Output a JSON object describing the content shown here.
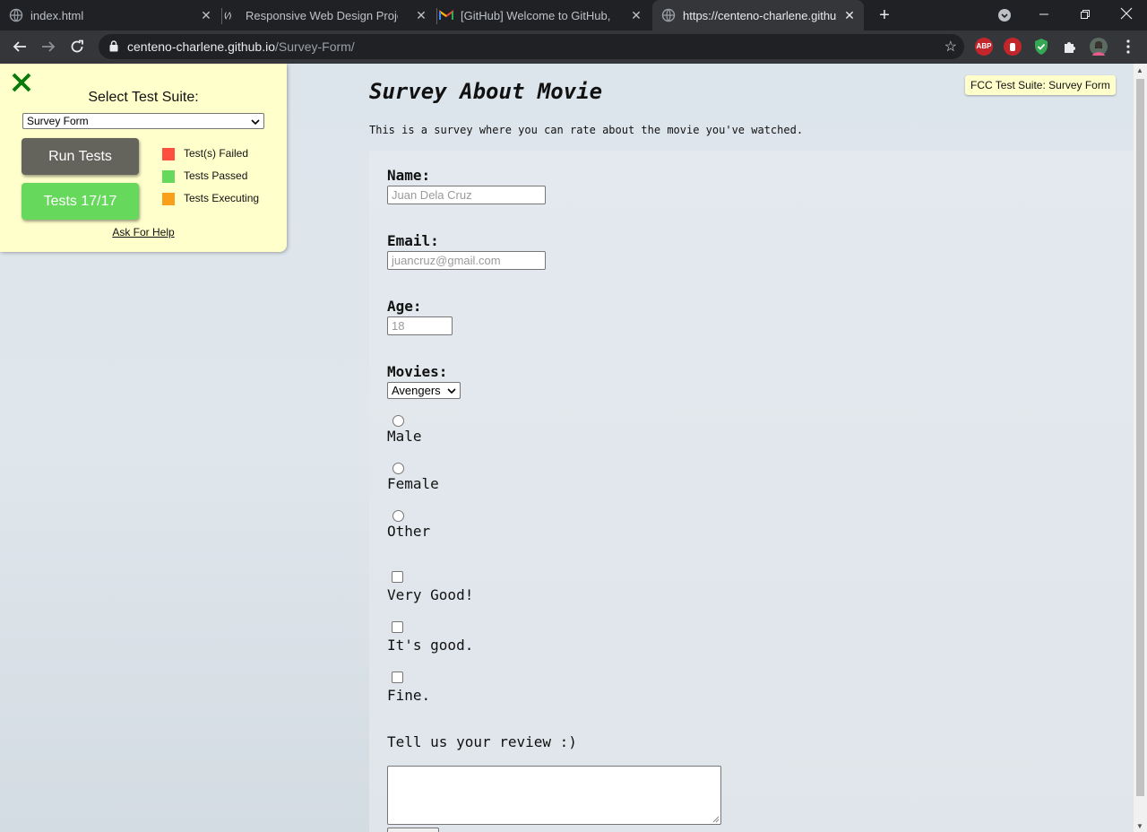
{
  "browser": {
    "tabs": [
      {
        "title": "index.html",
        "favicon": "globe-icon",
        "active": false
      },
      {
        "title": "Responsive Web Design Projects",
        "favicon": "freecodecamp-icon",
        "active": false
      },
      {
        "title": "[GitHub] Welcome to GitHub, @c",
        "favicon": "gmail-icon",
        "active": false
      },
      {
        "title": "https://centeno-charlene.github.i",
        "favicon": "globe-icon",
        "active": true
      }
    ],
    "url_host": "centeno-charlene.github.io",
    "url_path": "/Survey-Form/",
    "extensions": [
      "ABP",
      "adblock-hand-icon",
      "shield-icon",
      "puzzle-icon",
      "profile-avatar"
    ]
  },
  "fcc": {
    "select_label": "Select Test Suite:",
    "suite_value": "Survey Form",
    "run_label": "Run Tests",
    "tests_label": "Tests 17/17",
    "legend": [
      {
        "label": "Test(s) Failed",
        "color": "#ff4f3f"
      },
      {
        "label": "Tests Passed",
        "color": "#66d95c"
      },
      {
        "label": "Tests Executing",
        "color": "#f9a01b"
      }
    ],
    "help_label": "Ask For Help",
    "badge": "FCC Test Suite: Survey Form"
  },
  "survey": {
    "title": "Survey About Movie",
    "description": "This is a survey where you can rate about the movie you've watched.",
    "name_label": "Name:",
    "name_placeholder": "Juan Dela Cruz",
    "email_label": "Email:",
    "email_placeholder": "juancruz@gmail.com",
    "age_label": "Age:",
    "age_placeholder": "18",
    "movies_label": "Movies:",
    "movies_value": "Avengers",
    "genders": [
      "Male",
      "Female",
      "Other"
    ],
    "ratings": [
      "Very Good!",
      "It's good.",
      "Fine."
    ],
    "review_label": "Tell us your review :)"
  }
}
